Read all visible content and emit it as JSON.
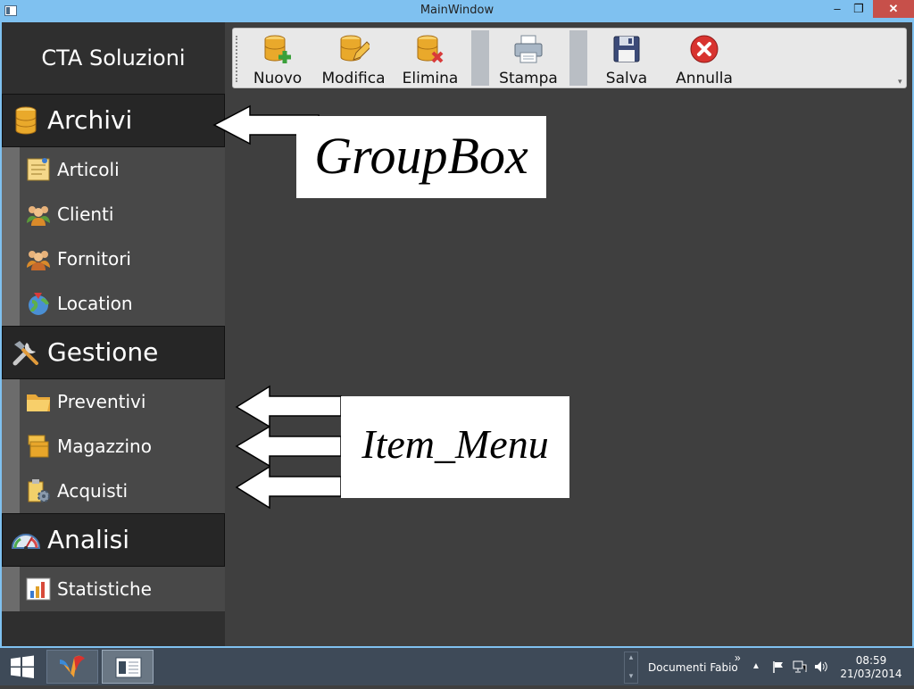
{
  "window": {
    "title": "MainWindow",
    "minimize": "–",
    "restore": "❐",
    "close": "✕"
  },
  "sidebar": {
    "brand": "CTA Soluzioni",
    "groups": [
      {
        "label": "Archivi",
        "icon": "database-icon",
        "items": [
          {
            "label": "Articoli",
            "icon": "notepad-icon"
          },
          {
            "label": "Clienti",
            "icon": "users-icon"
          },
          {
            "label": "Fornitori",
            "icon": "users-icon"
          },
          {
            "label": "Location",
            "icon": "globe-icon"
          }
        ]
      },
      {
        "label": "Gestione",
        "icon": "tools-icon",
        "items": [
          {
            "label": "Preventivi",
            "icon": "folder-icon"
          },
          {
            "label": "Magazzino",
            "icon": "boxes-icon"
          },
          {
            "label": "Acquisti",
            "icon": "clipboard-gear-icon"
          }
        ]
      },
      {
        "label": "Analisi",
        "icon": "gauge-icon",
        "items": [
          {
            "label": "Statistiche",
            "icon": "bar-chart-icon"
          }
        ]
      }
    ]
  },
  "toolbar": {
    "buttons": [
      {
        "label": "Nuovo",
        "icon": "database-add-icon"
      },
      {
        "label": "Modifica",
        "icon": "database-edit-icon"
      },
      {
        "label": "Elimina",
        "icon": "database-delete-icon"
      },
      {
        "label": "Stampa",
        "icon": "printer-icon"
      },
      {
        "label": "Salva",
        "icon": "floppy-icon"
      },
      {
        "label": "Annulla",
        "icon": "cancel-icon"
      }
    ],
    "overflow": "▾"
  },
  "annotations": {
    "groupbox": "GroupBox",
    "item_menu": "Item_Menu"
  },
  "taskbar": {
    "toolbar_name": "Documenti Fabio",
    "chevron": "»",
    "tray_arrow": "▲",
    "time": "08:59",
    "date": "21/03/2014"
  },
  "colors": {
    "titlebar": "#7fc1f0",
    "sidebar": "#2f2f2f",
    "group_header": "#262626",
    "item_panel": "#484848",
    "workspace": "#3f3f3f",
    "close": "#c7504a",
    "taskbar": "#3e4a58"
  }
}
